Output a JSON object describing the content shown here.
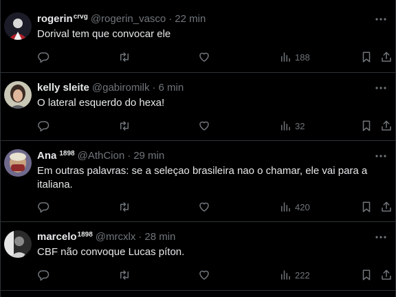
{
  "tweets": [
    {
      "name": "rogerin",
      "name_sup": "crvg",
      "handle": "@rogerin_vasco",
      "separator": "·",
      "time": "22 min",
      "text": "Dorival tem que convocar ele",
      "views": "188",
      "avatar_colors": [
        "#1c1c28",
        "#d9d9d9",
        "#b0202a"
      ]
    },
    {
      "name": "kelly sleite",
      "name_sup": "",
      "handle": "@gabiromilk",
      "separator": "·",
      "time": "6 min",
      "text": "O lateral esquerdo do hexa!",
      "views": "32",
      "avatar_colors": [
        "#c9c7b5",
        "#3a2a22",
        "#e0b79c"
      ]
    },
    {
      "name": "Ana",
      "name_sup": "1898",
      "handle": "@AthCion",
      "separator": "·",
      "time": "29 min",
      "text": "Em outras palavras: se a seleçao brasileira nao o chamar, ele vai para a italiana.",
      "views": "420",
      "avatar_colors": [
        "#6f6a8c",
        "#c8a27e",
        "#8e2a2a"
      ]
    },
    {
      "name": "marcelo",
      "name_sup": "1898",
      "handle": "@mrcxlx",
      "separator": "·",
      "time": "28 min",
      "text": "CBF não convoque Lucas píton.",
      "views": "222",
      "avatar_colors": [
        "#2b2b2b",
        "#e6e6e6",
        "#8a8a8a"
      ]
    }
  ],
  "icons": {
    "reply": "reply-icon",
    "retweet": "retweet-icon",
    "like": "like-icon",
    "views": "views-icon",
    "bookmark": "bookmark-icon",
    "share": "share-icon",
    "more": "more-icon"
  },
  "colors": {
    "background": "#000000",
    "text": "#e7e9ea",
    "muted": "#71767b",
    "divider": "#2f3336"
  }
}
